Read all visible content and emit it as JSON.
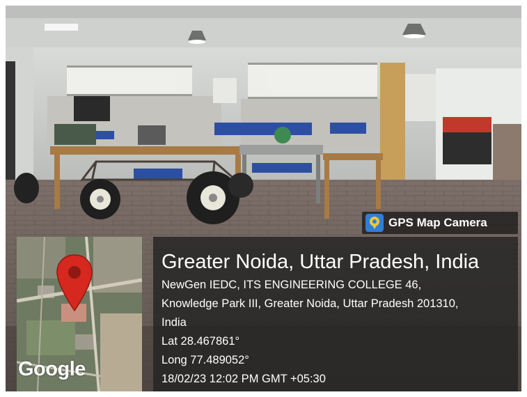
{
  "badge": {
    "label": "GPS Map Camera",
    "icon": "gps-map-camera-icon",
    "icon_colors": [
      "#2f7fd6",
      "#f3c53a"
    ]
  },
  "map": {
    "logo": "Google",
    "pin": "location-pin-icon",
    "pin_color": "#d6281e"
  },
  "location": {
    "title": "Greater Noida, Uttar Pradesh, India",
    "address_line1": "NewGen IEDC, ITS ENGINEERING COLLEGE 46,",
    "address_line2": "Knowledge Park III, Greater Noida, Uttar Pradesh 201310,",
    "address_line3": "India",
    "lat": "Lat 28.467861°",
    "long": "Long 77.489052°",
    "datetime": "18/02/23 12:02 PM GMT +05:30"
  }
}
